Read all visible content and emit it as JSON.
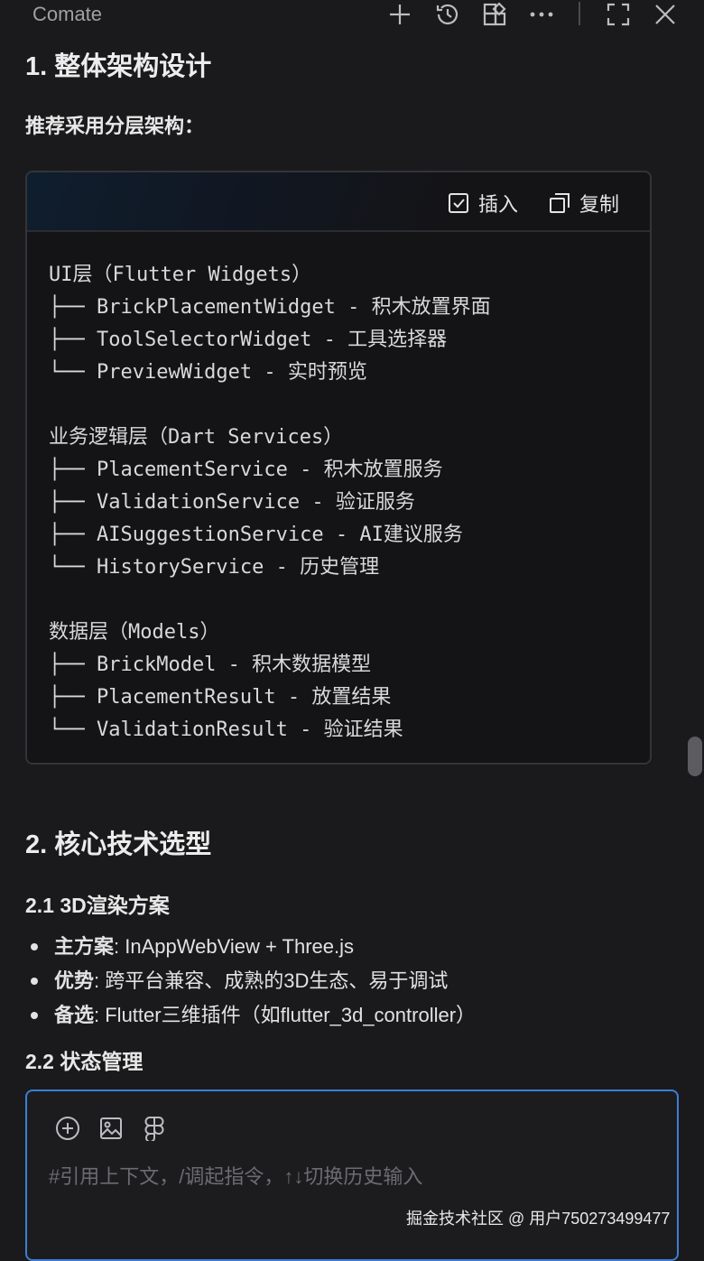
{
  "app": {
    "title": "Comate"
  },
  "toolbar": {
    "icons": [
      "plus-icon",
      "history-icon",
      "widgets-icon",
      "more-icon",
      "expand-icon",
      "close-icon"
    ]
  },
  "section1": {
    "title": "1. 整体架构设计",
    "lead": "推荐采用分层架构："
  },
  "codeblock": {
    "insert_label": "插入",
    "copy_label": "复制",
    "groups": [
      [
        "UI层（Flutter Widgets）",
        "├── BrickPlacementWidget - 积木放置界面",
        "├── ToolSelectorWidget - 工具选择器",
        "└── PreviewWidget - 实时预览"
      ],
      [
        "业务逻辑层（Dart Services）",
        "├── PlacementService - 积木放置服务",
        "├── ValidationService - 验证服务",
        "├── AISuggestionService - AI建议服务",
        "└── HistoryService - 历史管理"
      ],
      [
        "数据层（Models）",
        "├── BrickModel - 积木数据模型",
        "├── PlacementResult - 放置结果",
        "└── ValidationResult - 验证结果"
      ]
    ]
  },
  "section2": {
    "title": "2. 核心技术选型",
    "sub1": "2.1 3D渲染方案",
    "bullets": [
      {
        "label": "主方案",
        "text": ": InAppWebView + Three.js"
      },
      {
        "label": "优势",
        "text": ": 跨平台兼容、成熟的3D生态、易于调试"
      },
      {
        "label": "备选",
        "text": ": Flutter三维插件（如flutter_3d_controller）"
      }
    ],
    "sub2": "2.2 状态管理"
  },
  "composer": {
    "placeholder": "#引用上下文，/调起指令，↑↓切换历史输入",
    "icons": [
      "add-context-icon",
      "image-icon",
      "figma-icon"
    ]
  },
  "watermark": "掘金技术社区 @ 用户750273499477",
  "colors": {
    "accent": "#3b7fd4",
    "background": "#1a1a1c"
  }
}
